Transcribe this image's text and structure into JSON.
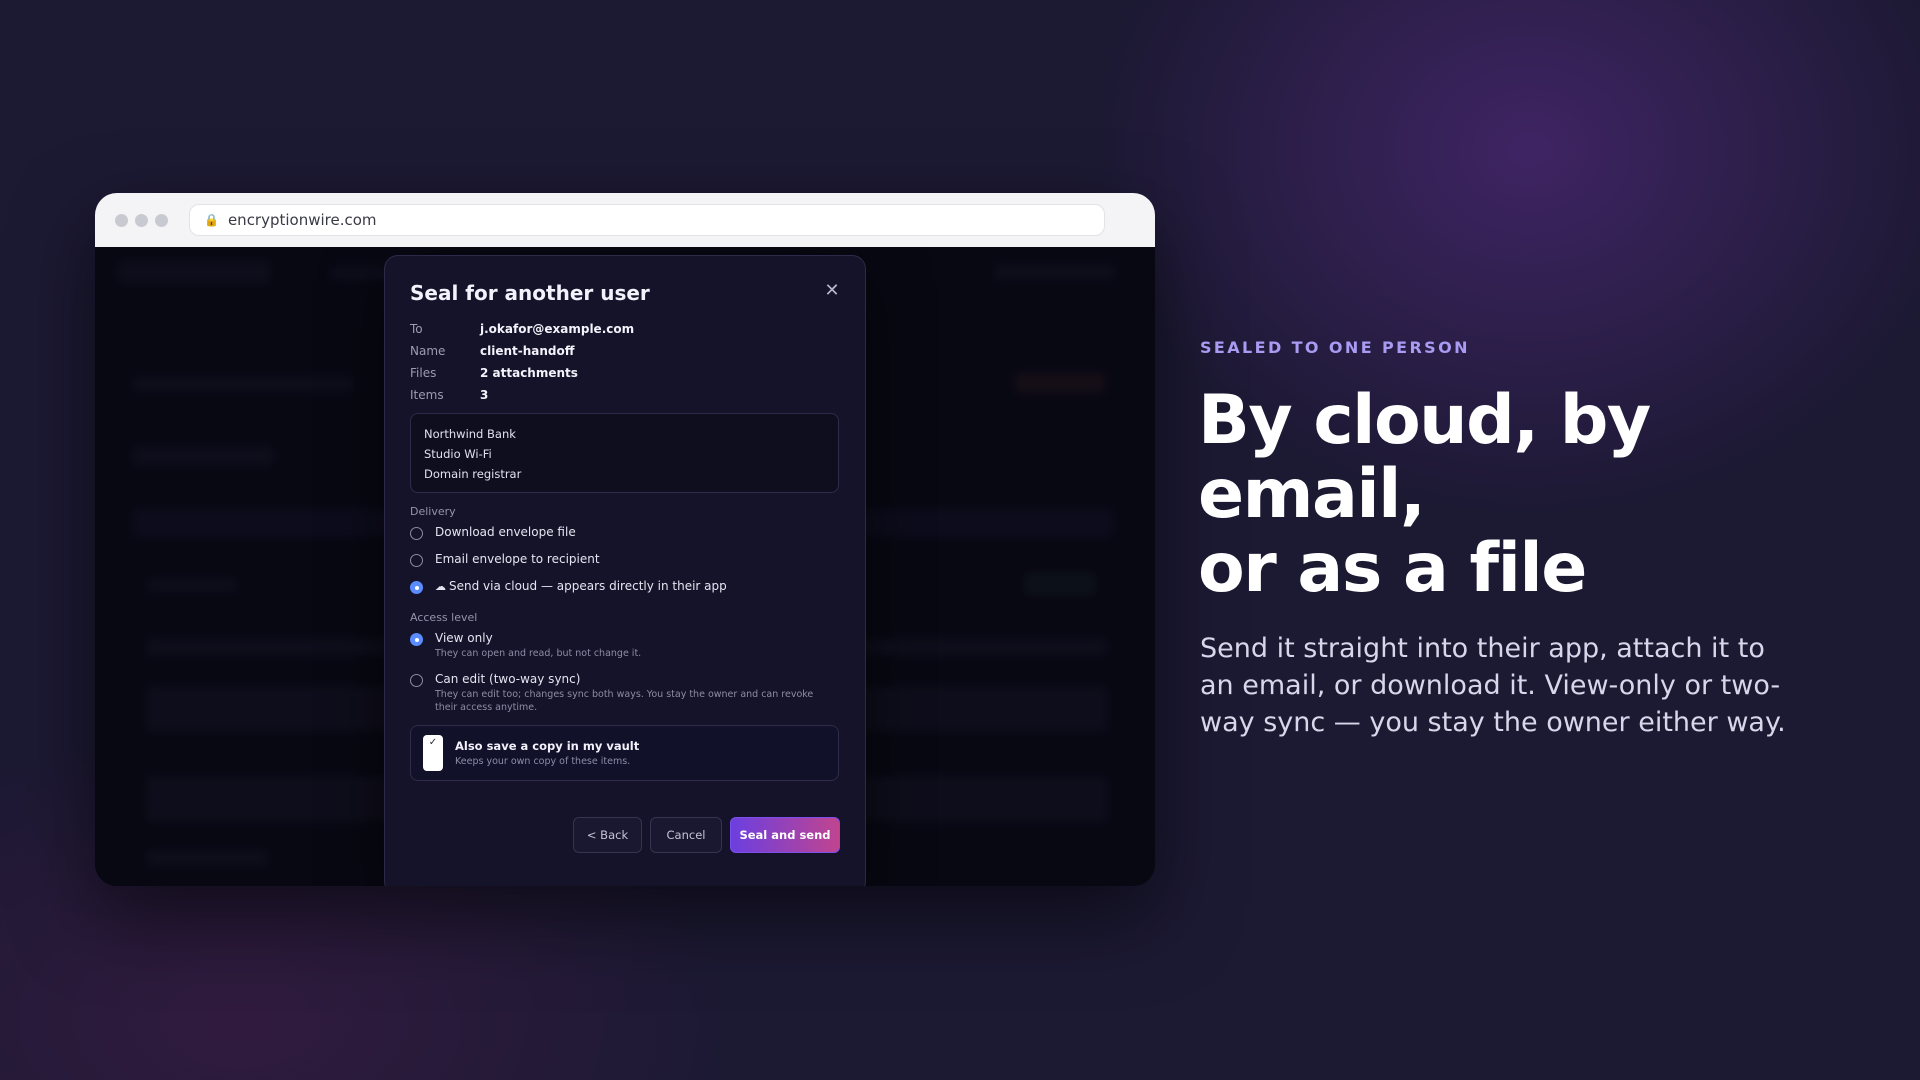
{
  "browser": {
    "url": "encryptionwire.com"
  },
  "modal": {
    "title": "Seal for another user",
    "close_icon": "close-icon",
    "meta": [
      {
        "label": "To",
        "value": "j.okafor@example.com"
      },
      {
        "label": "Name",
        "value": "client-handoff"
      },
      {
        "label": "Files",
        "value": "2 attachments"
      },
      {
        "label": "Items",
        "value": "3"
      }
    ],
    "items": [
      "Northwind Bank",
      "Studio Wi-Fi",
      "Domain registrar"
    ],
    "delivery": {
      "label": "Delivery",
      "options": [
        {
          "label": "Download envelope file",
          "selected": false
        },
        {
          "label": "Email envelope to recipient",
          "selected": false
        },
        {
          "label": "Send via cloud — appears directly in their app",
          "selected": true
        }
      ]
    },
    "access": {
      "label": "Access level",
      "options": [
        {
          "label": "View only",
          "description": "They can open and read, but not change it.",
          "selected": true
        },
        {
          "label": "Can edit (two-way sync)",
          "description": "They can edit too; changes sync both ways. You stay the owner and can revoke their access anytime.",
          "selected": false
        }
      ]
    },
    "save_copy": {
      "title": "Also save a copy in my vault",
      "description": "Keeps your own copy of these items.",
      "checked": true
    },
    "buttons": {
      "back": "< Back",
      "cancel": "Cancel",
      "primary": "Seal and send"
    }
  },
  "hero": {
    "eyebrow": "SEALED TO ONE PERSON",
    "headline_lines": [
      "By cloud, by",
      "email,",
      "or as a file"
    ],
    "subtext": "Send it straight into their app, attach it to an email, or download it. View-only or two-way sync — you stay the owner either way."
  },
  "colors": {
    "background": "#1c1933",
    "accent": "#5b8cff",
    "primary_gradient_start": "#6b3fe0",
    "primary_gradient_end": "#c0448f",
    "eyebrow": "#a99bf2"
  }
}
